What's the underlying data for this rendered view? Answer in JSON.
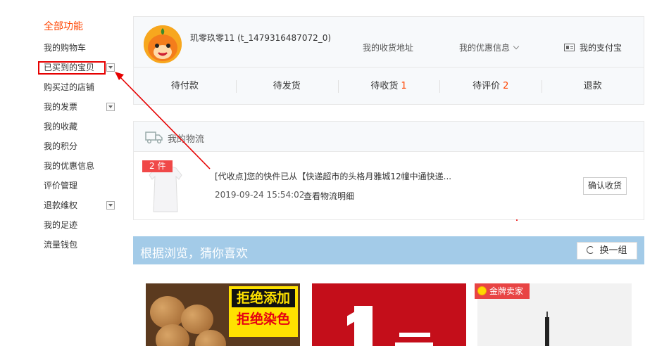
{
  "sidebar": {
    "heading": "全部功能",
    "items": [
      {
        "label": "我的购物车"
      },
      {
        "label": "已买到的宝贝"
      },
      {
        "label": "购买过的店铺"
      },
      {
        "label": "我的发票"
      },
      {
        "label": "我的收藏"
      },
      {
        "label": "我的积分"
      },
      {
        "label": "我的优惠信息"
      },
      {
        "label": "评价管理"
      },
      {
        "label": "退款维权"
      },
      {
        "label": "我的足迹"
      },
      {
        "label": "流量钱包"
      }
    ]
  },
  "user": {
    "name": "玑零玖零11 (t_1479316487072_0)",
    "links": {
      "address": "我的收货地址",
      "coupons": "我的优惠信息",
      "alipay": "我的支付宝"
    }
  },
  "orders": [
    {
      "label": "待付款",
      "count": ""
    },
    {
      "label": "待发货",
      "count": ""
    },
    {
      "label": "待收货",
      "count": "1"
    },
    {
      "label": "待评价",
      "count": "2"
    },
    {
      "label": "退款",
      "count": ""
    }
  ],
  "logistics": {
    "title": "我的物流",
    "item_count": "2 件",
    "message": "[代收点]您的快件已从【快递超市的头格月雅城12幢中通快递...",
    "time": "2019-09-24 15:54:02",
    "detail_link": "查看物流明细",
    "confirm_label": "确认收货"
  },
  "recommend": {
    "title": "根据浏览，猜你喜欢",
    "swap_label": "换一组",
    "cards": [
      {
        "banner_line1": "拒绝添加",
        "banner_line2": "拒绝染色"
      },
      {},
      {
        "badge": "金牌卖家"
      }
    ]
  },
  "colors": {
    "accent": "#ff4400",
    "annotation_red": "#e60000",
    "reco_bar": "#a3cbe8"
  }
}
